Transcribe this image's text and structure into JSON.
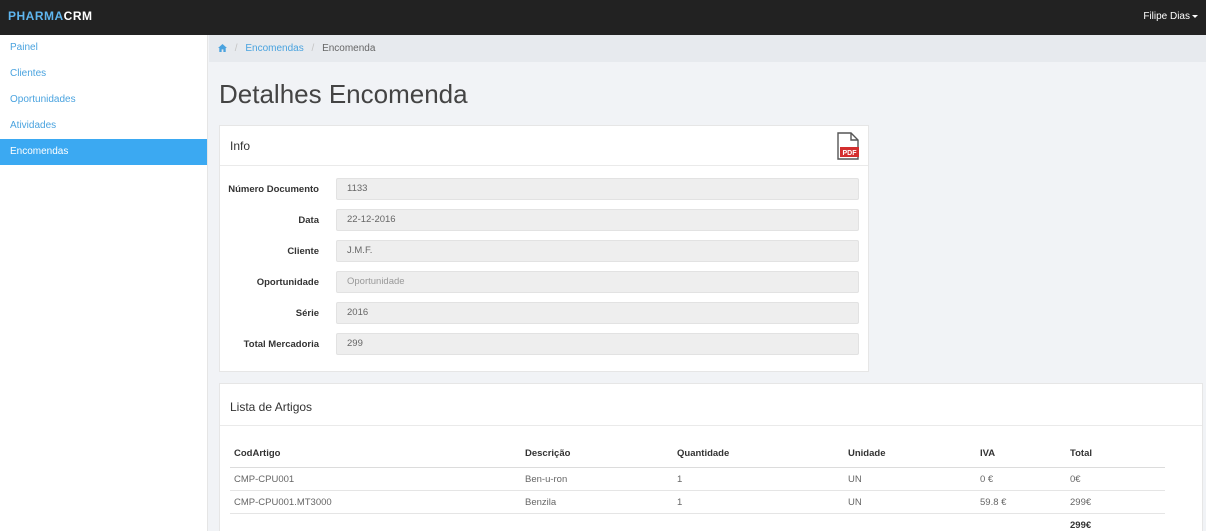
{
  "app": {
    "brand_part1": "PHARMA",
    "brand_part2": "CRM",
    "user_name": "Filipe Dias"
  },
  "colors": {
    "accent": "#3ba9f2",
    "topbar": "#222222",
    "link": "#4aa3df",
    "pdf_red": "#d32f2f"
  },
  "sidebar": {
    "items": [
      {
        "label": "Painel",
        "active": false
      },
      {
        "label": "Clientes",
        "active": false
      },
      {
        "label": "Oportunidades",
        "active": false
      },
      {
        "label": "Atividades",
        "active": false
      },
      {
        "label": "Encomendas",
        "active": true
      }
    ]
  },
  "breadcrumb": {
    "home_icon": "home-icon",
    "link": "Encomendas",
    "current": "Encomenda"
  },
  "page": {
    "title": "Detalhes Encomenda"
  },
  "info": {
    "title": "Info",
    "pdf_label": "PDF",
    "fields": [
      {
        "label": "Número Documento",
        "value": "1133",
        "placeholder": false
      },
      {
        "label": "Data",
        "value": "22-12-2016",
        "placeholder": false
      },
      {
        "label": "Cliente",
        "value": "J.M.F.",
        "placeholder": false
      },
      {
        "label": "Oportunidade",
        "value": "Oportunidade",
        "placeholder": true
      },
      {
        "label": "Série",
        "value": "2016",
        "placeholder": false
      },
      {
        "label": "Total Mercadoria",
        "value": "299",
        "placeholder": false
      }
    ]
  },
  "items_list": {
    "title": "Lista de Artigos",
    "columns": [
      "CodArtigo",
      "Descrição",
      "Quantidade",
      "Unidade",
      "IVA",
      "Total"
    ],
    "rows": [
      [
        "CMP-CPU001",
        "Ben-u-ron",
        "1",
        "UN",
        "0 €",
        "0€"
      ],
      [
        "CMP-CPU001.MT3000",
        "Benzila",
        "1",
        "UN",
        "59.8 €",
        "299€"
      ]
    ],
    "grand_total": "299€"
  }
}
